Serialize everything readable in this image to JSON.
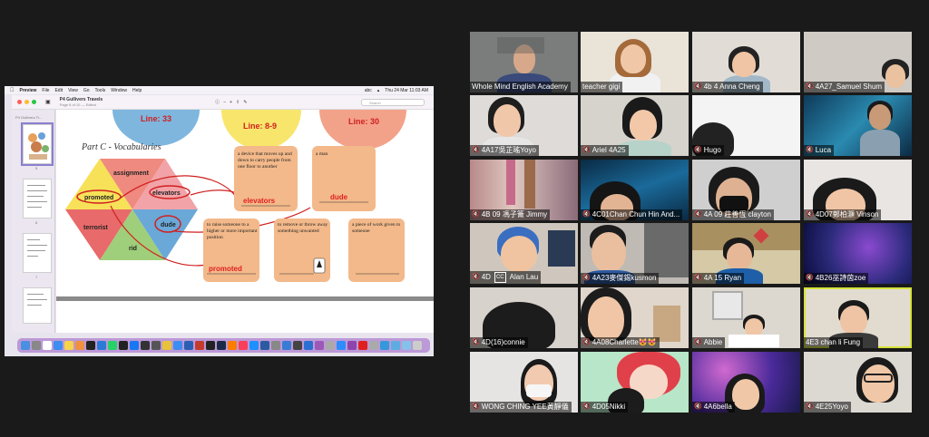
{
  "shared_screen": {
    "menubar": {
      "app": "Preview",
      "items": [
        "File",
        "Edit",
        "View",
        "Go",
        "Tools",
        "Window",
        "Help"
      ],
      "clock": "Thu 24 Mar 11:03 AM",
      "wifi": "abc"
    },
    "window": {
      "title": "P4 Gullivers Travels",
      "subtitle": "Page 6 of 10 — Edited",
      "search_placeholder": "Search",
      "sidebar_label": "P4 Gullivers Tr...",
      "thumb_numbers": [
        "5",
        "6",
        "7",
        "8",
        "9"
      ]
    },
    "document": {
      "lines": [
        "Line: 33",
        "Line: 8-9",
        "Line: 30"
      ],
      "heading": "Part C - Vocabularies",
      "hexagon_words": [
        "assignment",
        "promoted",
        "elevators",
        "terrorist",
        "dude",
        "rid"
      ],
      "cards": [
        {
          "definition": "a device that moves up and down to carry people from one floor to another",
          "answer": "elevators"
        },
        {
          "definition": "a man",
          "answer": "dude"
        },
        {
          "definition": "to raise someone to a higher or more important position",
          "answer": "promoted"
        },
        {
          "definition": "to remove or throw away something unwanted",
          "answer": ""
        },
        {
          "definition": "a piece of work given to someone",
          "answer": ""
        }
      ]
    }
  },
  "participants": [
    "Whole Mind English Academy",
    "teacher gigi",
    "4b  4 Anna Cheng",
    "4A27_Samuel Shum",
    "4A17吳芷瑤Yoyo",
    "Ariel 4A25",
    "Hugo",
    "Luca",
    "4B  09  馮子籥  Jimmy",
    "4C01Chan Chun Hin And...",
    "4A 09 莊善恆 clayton",
    "4D07鄭柏灝 Vinson",
    "Alan Lau",
    "4A23麥傑錫kusmon",
    "4A 15 Ryan",
    "4B26巫詩茵zoe",
    "4D(16)connie",
    "4A08Charlette😻😻",
    "Abbie",
    "4E3 chan li Fung",
    "WONG CHING YEE黃靜儀",
    "4D05Nikki",
    "4A6bella",
    "4E25Yoyo"
  ],
  "participant_extra": {
    "alan_prefix": "4D",
    "alan_badge": "CC"
  },
  "colors": {
    "background": "#1a1a1a",
    "active_speaker_border": "#d6e23a",
    "muted_mic": "#e33333",
    "answer_red": "#e02020",
    "card_orange": "#f3b98a"
  }
}
